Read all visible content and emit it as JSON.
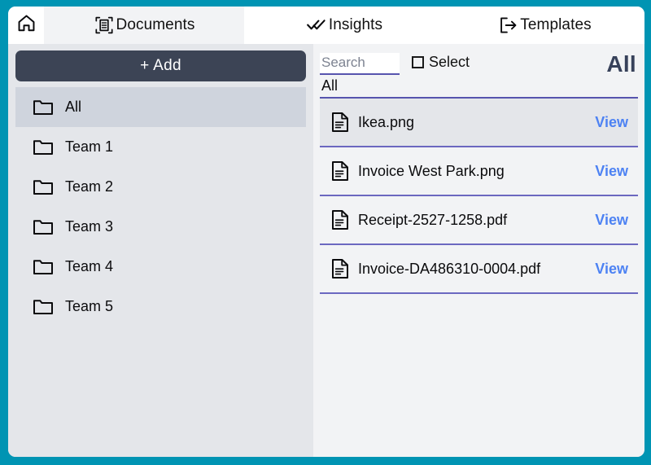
{
  "window": {
    "frame_color": "#0094b3",
    "accent_purple": "#5754ae",
    "link_blue": "#4d82f3",
    "button_dark": "#3c4455"
  },
  "tabs": {
    "home_icon": "home-icon",
    "items": [
      {
        "label": "Documents",
        "icon": "document-scan-icon",
        "active": true
      },
      {
        "label": "Insights",
        "icon": "double-check-icon",
        "active": false
      },
      {
        "label": "Templates",
        "icon": "export-arrow-icon",
        "active": false
      }
    ]
  },
  "sidebar": {
    "add_label": "+ Add",
    "items": [
      {
        "label": "All",
        "icon": "folder-icon",
        "selected": true
      },
      {
        "label": "Team 1",
        "icon": "folder-icon",
        "selected": false
      },
      {
        "label": "Team 2",
        "icon": "folder-icon",
        "selected": false
      },
      {
        "label": "Team 3",
        "icon": "folder-icon",
        "selected": false
      },
      {
        "label": "Team 4",
        "icon": "folder-icon",
        "selected": false
      },
      {
        "label": "Team 5",
        "icon": "folder-icon",
        "selected": false
      }
    ]
  },
  "documents": {
    "search": {
      "value": "",
      "placeholder": "Search"
    },
    "select_label": "Select",
    "select_checked": false,
    "scope_title": "All",
    "breadcrumb": "All",
    "view_label": "View",
    "files": [
      {
        "name": "Ikea.png",
        "icon": "file-icon",
        "highlight": true
      },
      {
        "name": "Invoice West Park.png",
        "icon": "file-icon",
        "highlight": false
      },
      {
        "name": "Receipt-2527-1258.pdf",
        "icon": "file-icon",
        "highlight": false
      },
      {
        "name": "Invoice-DA486310-0004.pdf",
        "icon": "file-icon",
        "highlight": false
      }
    ]
  }
}
